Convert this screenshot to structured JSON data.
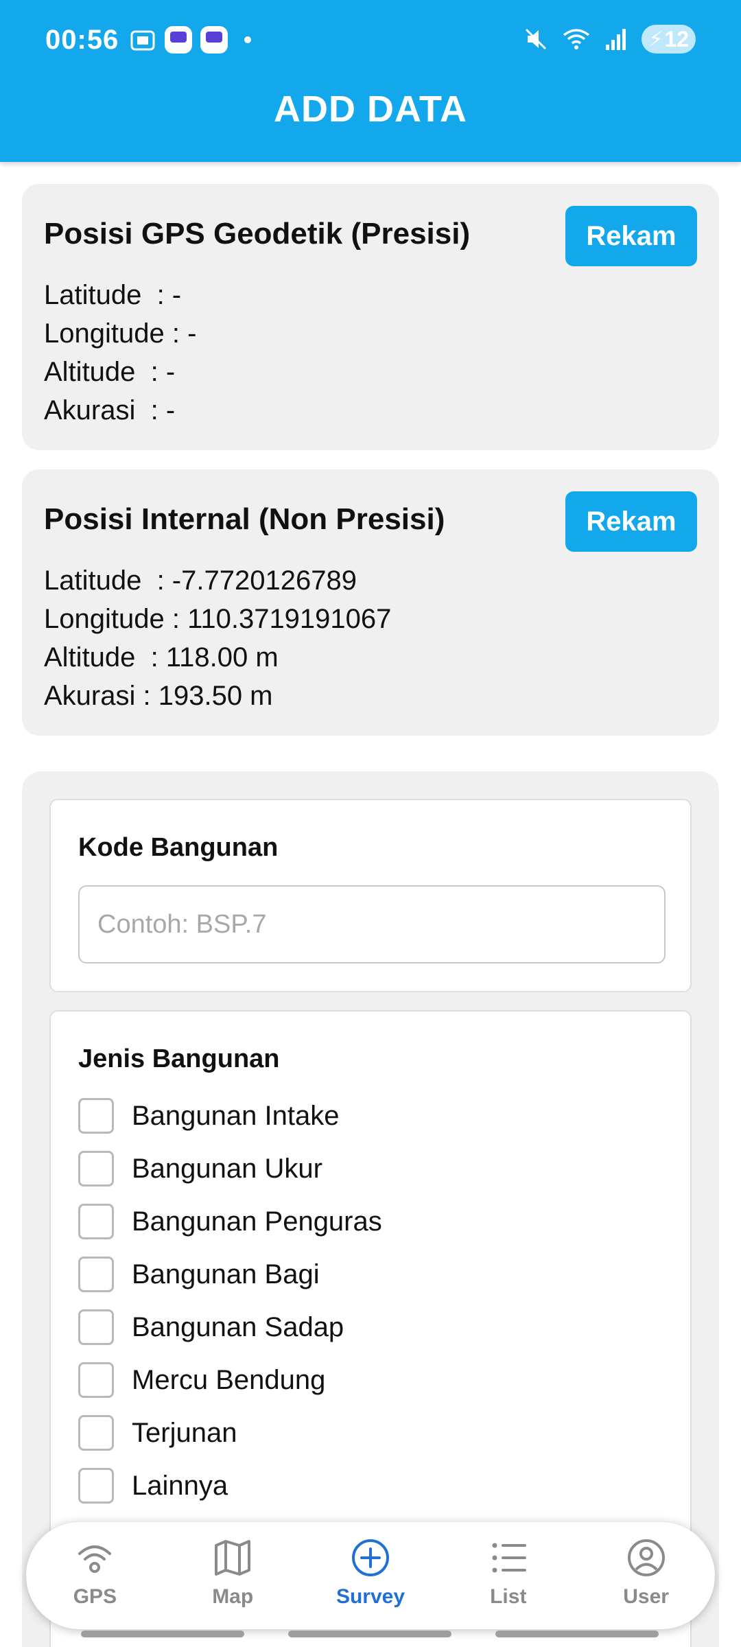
{
  "status_bar": {
    "time": "00:56",
    "battery_level": "12"
  },
  "header": {
    "title": "ADD DATA",
    "color": "#13a8eb"
  },
  "gps_card": {
    "title": "Posisi GPS Geodetik (Presisi)",
    "button_label": "Rekam",
    "latitude": "Latitude  : -",
    "longitude": "Longitude : -",
    "altitude": "Altitude  : -",
    "akurasi": "Akurasi  : -"
  },
  "internal_card": {
    "title": "Posisi Internal (Non Presisi)",
    "button_label": "Rekam",
    "latitude": "Latitude  : -7.7720126789",
    "longitude": "Longitude : 110.3719191067",
    "altitude": "Altitude  : 118.00 m",
    "akurasi": "Akurasi : 193.50 m"
  },
  "kode_bangunan": {
    "label": "Kode Bangunan",
    "value": "",
    "placeholder": "Contoh: BSP.7"
  },
  "jenis_bangunan": {
    "label": "Jenis Bangunan",
    "options": [
      {
        "label": "Bangunan Intake",
        "checked": false
      },
      {
        "label": "Bangunan Ukur",
        "checked": false
      },
      {
        "label": "Bangunan Penguras",
        "checked": false
      },
      {
        "label": "Bangunan Bagi",
        "checked": false
      },
      {
        "label": "Bangunan Sadap",
        "checked": false
      },
      {
        "label": "Mercu Bendung",
        "checked": false
      },
      {
        "label": "Terjunan",
        "checked": false
      },
      {
        "label": "Lainnya",
        "checked": false
      }
    ]
  },
  "bottom_nav": {
    "items": [
      {
        "label": "GPS",
        "icon": "gps-signal-icon",
        "active": false
      },
      {
        "label": "Map",
        "icon": "map-icon",
        "active": false
      },
      {
        "label": "Survey",
        "icon": "add-circle-icon",
        "active": true
      },
      {
        "label": "List",
        "icon": "list-icon",
        "active": false
      },
      {
        "label": "User",
        "icon": "user-icon",
        "active": false
      }
    ],
    "active_color": "#1f6fd6"
  }
}
